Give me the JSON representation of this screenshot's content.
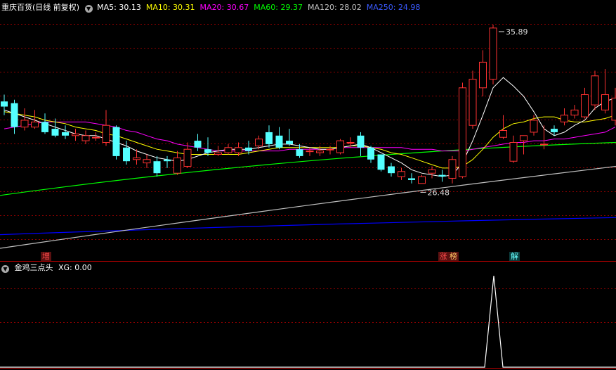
{
  "header": {
    "title": "重庆百货(日线 前复权)",
    "indicators": [
      {
        "label": "MA5:",
        "value": "30.13",
        "color": "#ffffff"
      },
      {
        "label": "MA10:",
        "value": "30.31",
        "color": "#ffff00"
      },
      {
        "label": "MA20:",
        "value": "30.67",
        "color": "#ff00ff"
      },
      {
        "label": "MA60:",
        "value": "29.37",
        "color": "#00ff00"
      },
      {
        "label": "MA120:",
        "value": "28.02",
        "color": "#c0c0c0"
      },
      {
        "label": "MA250:",
        "value": "24.98",
        "color": "#0000ff"
      }
    ]
  },
  "sub_header": {
    "title": "金鸡三点头",
    "xg_label": "XG:",
    "xg_value": "0.00"
  },
  "event_tags": [
    {
      "text": "增",
      "index": 4,
      "color": "#ff4d4d",
      "bg": "#5a1010"
    },
    {
      "text": "涨",
      "index": 43,
      "color": "#ff4d4d",
      "bg": "#5a1010"
    },
    {
      "text": "榜",
      "index": 44,
      "color": "#ffcc66",
      "bg": "#5a1010"
    },
    {
      "text": "解",
      "index": 50,
      "color": "#66ffff",
      "bg": "#0a3a3a"
    }
  ],
  "annotations": {
    "high_text": "35.89",
    "low_text": "26.48"
  },
  "colors": {
    "up": "#ff3232",
    "down": "#54ffff",
    "grid": "#8b0000",
    "separator": "#b00000",
    "ma5": "#ffffff",
    "ma10": "#ffff00",
    "ma20": "#ff00ff",
    "ma60": "#00ff00",
    "ma120": "#c0c0c0",
    "ma250": "#0000ff",
    "xg": "#ffffff"
  },
  "chart_data": [
    {
      "type": "candlestick",
      "x_step": 14.5,
      "ylim": [
        22.5,
        37.0
      ],
      "series_candles": {
        "open": [
          31.8,
          31.7,
          30.3,
          30.3,
          30.6,
          30.2,
          30.0,
          29.8,
          29.5,
          29.7,
          29.4,
          30.3,
          29.1,
          28.4,
          28.2,
          28.3,
          28.4,
          27.6,
          28.0,
          29.5,
          29.0,
          28.7,
          28.8,
          28.8,
          29.1,
          29.2,
          30.0,
          29.8,
          29.5,
          29.0,
          28.9,
          28.8,
          29.0,
          28.8,
          29.4,
          29.8,
          29.1,
          28.7,
          28.0,
          27.4,
          27.3,
          27.0,
          27.6,
          27.5,
          27.3,
          27.4,
          30.4,
          32.6,
          33.1,
          29.7,
          28.3,
          29.5,
          30.0,
          29.3,
          30.2,
          30.6,
          31.0,
          30.9,
          31.6,
          31.3,
          30.7
        ],
        "close": [
          31.5,
          30.3,
          30.7,
          30.6,
          30.0,
          29.8,
          29.8,
          29.9,
          29.8,
          29.7,
          30.4,
          28.6,
          28.3,
          28.5,
          28.4,
          27.6,
          28.3,
          28.5,
          29.0,
          29.1,
          28.8,
          28.8,
          29.1,
          29.1,
          28.9,
          29.6,
          29.3,
          29.1,
          29.3,
          28.6,
          28.9,
          28.9,
          29.0,
          29.5,
          29.4,
          29.1,
          28.4,
          27.8,
          27.6,
          27.7,
          27.2,
          27.4,
          27.8,
          27.4,
          28.4,
          32.6,
          33.1,
          34.1,
          36.1,
          30.1,
          29.4,
          29.8,
          30.7,
          29.3,
          30.0,
          31.0,
          31.3,
          32.2,
          33.3,
          32.2,
          32.0
        ],
        "high": [
          32.2,
          31.9,
          31.4,
          31.3,
          31.1,
          30.8,
          30.4,
          30.2,
          30.1,
          30.0,
          31.3,
          30.4,
          29.5,
          29.0,
          28.7,
          28.6,
          28.6,
          28.9,
          29.4,
          29.9,
          29.7,
          29.2,
          29.3,
          29.4,
          29.5,
          29.8,
          30.4,
          30.3,
          30.2,
          29.3,
          29.1,
          29.2,
          29.2,
          29.6,
          29.7,
          30.0,
          29.2,
          28.7,
          28.2,
          27.9,
          27.6,
          27.5,
          28.0,
          27.8,
          28.6,
          32.9,
          33.6,
          34.8,
          36.3,
          31.0,
          29.8,
          29.8,
          31.0,
          30.4,
          30.4,
          31.4,
          31.6,
          32.6,
          33.6,
          33.7,
          32.6
        ],
        "low": [
          31.0,
          29.9,
          30.1,
          30.2,
          29.9,
          29.7,
          29.6,
          29.5,
          29.3,
          29.5,
          29.2,
          28.4,
          28.1,
          28.1,
          27.9,
          27.4,
          27.9,
          27.5,
          27.9,
          28.9,
          28.6,
          28.6,
          28.7,
          28.6,
          28.7,
          29.0,
          29.1,
          29.0,
          29.2,
          28.5,
          28.6,
          28.6,
          28.7,
          28.7,
          29.1,
          28.6,
          28.2,
          27.7,
          27.4,
          27.2,
          27.0,
          27.2,
          27.3,
          27.1,
          27.0,
          27.3,
          30.2,
          32.1,
          32.8,
          29.6,
          28.2,
          28.7,
          29.8,
          29.0,
          29.8,
          30.4,
          30.8,
          30.8,
          31.3,
          31.1,
          30.4
        ]
      },
      "moving_averages": {
        "MA5": [
          31.3,
          31.1,
          30.9,
          30.7,
          30.5,
          30.3,
          30.1,
          29.9,
          29.8,
          29.8,
          29.6,
          29.4,
          29.2,
          28.9,
          28.7,
          28.5,
          28.4,
          28.3,
          28.4,
          28.6,
          28.8,
          28.9,
          29.0,
          29.0,
          29.0,
          29.1,
          29.2,
          29.3,
          29.3,
          29.2,
          29.1,
          29.0,
          29.0,
          29.1,
          29.2,
          29.3,
          29.1,
          28.8,
          28.5,
          28.2,
          27.8,
          27.6,
          27.5,
          27.4,
          27.5,
          28.2,
          29.5,
          31.0,
          32.6,
          33.2,
          32.7,
          32.1,
          31.2,
          30.2,
          29.8,
          30.0,
          30.4,
          30.7,
          31.4,
          31.8,
          32.0
        ],
        "MA10": [
          31.2,
          31.1,
          31.0,
          30.9,
          30.7,
          30.6,
          30.5,
          30.3,
          30.2,
          30.1,
          29.9,
          29.8,
          29.6,
          29.4,
          29.2,
          29.0,
          28.9,
          28.8,
          28.7,
          28.7,
          28.7,
          28.7,
          28.7,
          28.7,
          28.8,
          28.9,
          29.0,
          29.1,
          29.1,
          29.1,
          29.1,
          29.1,
          29.1,
          29.1,
          29.2,
          29.2,
          29.1,
          29.0,
          28.8,
          28.7,
          28.5,
          28.3,
          28.1,
          27.9,
          27.9,
          28.0,
          28.4,
          29.0,
          29.7,
          30.2,
          30.5,
          30.6,
          30.8,
          30.9,
          30.9,
          30.7,
          30.6,
          30.6,
          30.7,
          30.8,
          31.0
        ],
        "MA20": [
          30.2,
          30.3,
          30.4,
          30.5,
          30.6,
          30.6,
          30.6,
          30.6,
          30.6,
          30.5,
          30.4,
          30.3,
          30.1,
          30.0,
          29.8,
          29.6,
          29.5,
          29.3,
          29.2,
          29.1,
          29.0,
          28.9,
          28.9,
          28.9,
          28.9,
          28.9,
          28.9,
          28.9,
          29.0,
          29.0,
          29.0,
          29.0,
          29.0,
          29.1,
          29.1,
          29.1,
          29.1,
          29.1,
          29.1,
          29.1,
          29.0,
          29.0,
          29.0,
          28.9,
          28.9,
          28.9,
          29.0,
          29.1,
          29.2,
          29.3,
          29.4,
          29.4,
          29.5,
          29.5,
          29.6,
          29.6,
          29.7,
          29.8,
          29.9,
          30.0,
          30.3
        ]
      },
      "long_lines": {
        "MA60": {
          "start": 26.3,
          "end": 29.4
        },
        "MA120": {
          "start": 23.2,
          "end": 28.0
        },
        "MA250": {
          "start": 24.0,
          "end": 25.0
        }
      },
      "high_marker": {
        "index": 48,
        "price": 35.89
      },
      "low_marker": {
        "index": 41,
        "price": 26.48
      }
    },
    {
      "type": "line",
      "name": "XG",
      "signal_index": 48,
      "signal_value": 1,
      "ylim": [
        0,
        1
      ]
    }
  ]
}
